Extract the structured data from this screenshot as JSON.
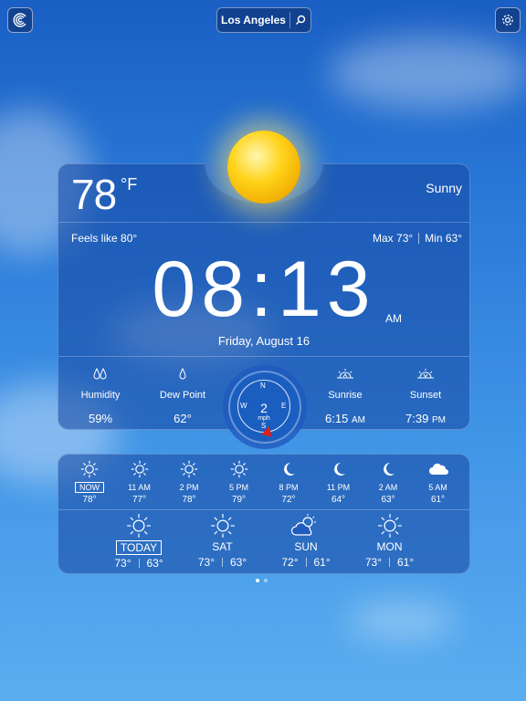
{
  "header": {
    "city": "Los Angeles",
    "left_icon": "app-logo-icon",
    "search_icon": "search-icon",
    "settings_icon": "gear-icon"
  },
  "current": {
    "temp": "78",
    "unit": "°F",
    "condition": "Sunny",
    "feels_like": "Feels like 80°",
    "max": "Max 73°",
    "min": "Min 63°",
    "time": "08:13",
    "ampm": "AM",
    "date": "Friday, August 16"
  },
  "stats": {
    "humidity_label": "Humidity",
    "humidity_value": "59%",
    "dew_label": "Dew Point",
    "dew_value": "62°",
    "sunrise_label": "Sunrise",
    "sunrise_time": "6:15",
    "sunrise_ampm": "AM",
    "sunset_label": "Sunset",
    "sunset_time": "7:39",
    "sunset_ampm": "PM"
  },
  "wind": {
    "speed": "2",
    "unit": "mph",
    "dirs": {
      "n": "N",
      "e": "E",
      "s": "S",
      "w": "W"
    }
  },
  "hourly": [
    {
      "label": "NOW",
      "temp": "78°",
      "icon": "sun-icon"
    },
    {
      "label": "11 AM",
      "temp": "77°",
      "icon": "sun-icon"
    },
    {
      "label": "2 PM",
      "temp": "78°",
      "icon": "sun-icon"
    },
    {
      "label": "5 PM",
      "temp": "79°",
      "icon": "sun-icon"
    },
    {
      "label": "8 PM",
      "temp": "72°",
      "icon": "moon-icon"
    },
    {
      "label": "11 PM",
      "temp": "64°",
      "icon": "moon-icon"
    },
    {
      "label": "2 AM",
      "temp": "63°",
      "icon": "moon-icon"
    },
    {
      "label": "5 AM",
      "temp": "61°",
      "icon": "cloud-icon"
    }
  ],
  "daily": [
    {
      "label": "TODAY",
      "high": "73°",
      "low": "63°",
      "icon": "sun-icon"
    },
    {
      "label": "SAT",
      "high": "73°",
      "low": "63°",
      "icon": "sun-icon"
    },
    {
      "label": "SUN",
      "high": "72°",
      "low": "61°",
      "icon": "partly-cloudy-icon"
    },
    {
      "label": "MON",
      "high": "73°",
      "low": "61°",
      "icon": "sun-icon"
    }
  ],
  "pages": {
    "count": 2,
    "active": 1
  }
}
